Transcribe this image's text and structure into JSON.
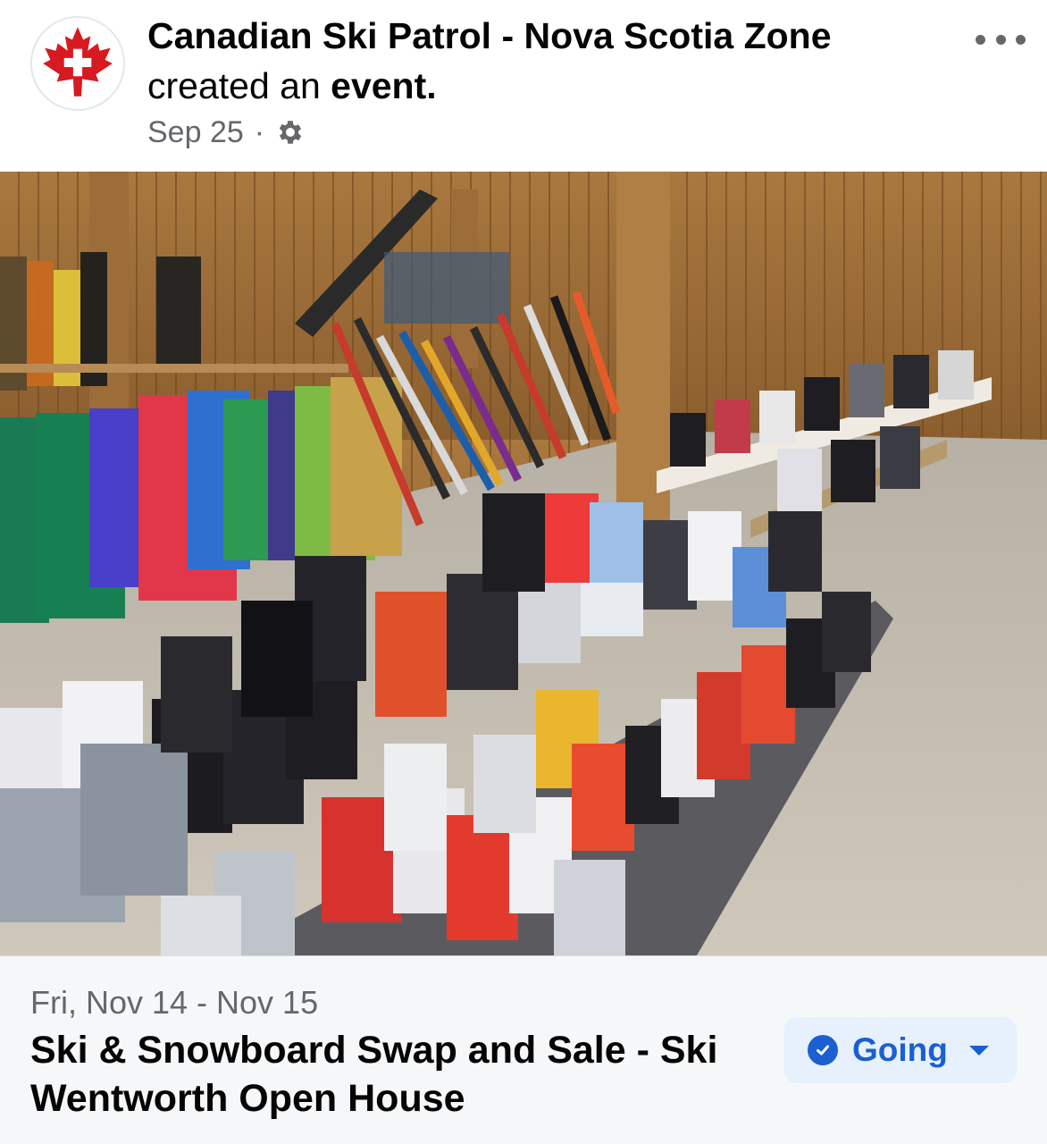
{
  "post": {
    "author": "Canadian Ski Patrol - Nova Scotia Zone",
    "action_prefix": "created an ",
    "action_object": "event.",
    "date": "Sep 25",
    "separator": "·",
    "privacy_icon": "gear-icon",
    "more_icon": "more-options-icon",
    "avatar_icon": "maple-leaf-cross-logo"
  },
  "photo": {
    "subject": "ski-swap-equipment-photo"
  },
  "event": {
    "date_range": "Fri, Nov 14 - Nov 15",
    "title": "Ski & Snowboard Swap and Sale - Ski Wentworth Open House",
    "rsvp": {
      "label": "Going",
      "icon": "check-circle-icon",
      "dropdown_icon": "caret-down-icon"
    }
  },
  "colors": {
    "accent": "#1b5fd1",
    "rsvp_bg": "#e7f0fd",
    "secondary_text": "#65676b",
    "logo_red": "#d71920"
  }
}
